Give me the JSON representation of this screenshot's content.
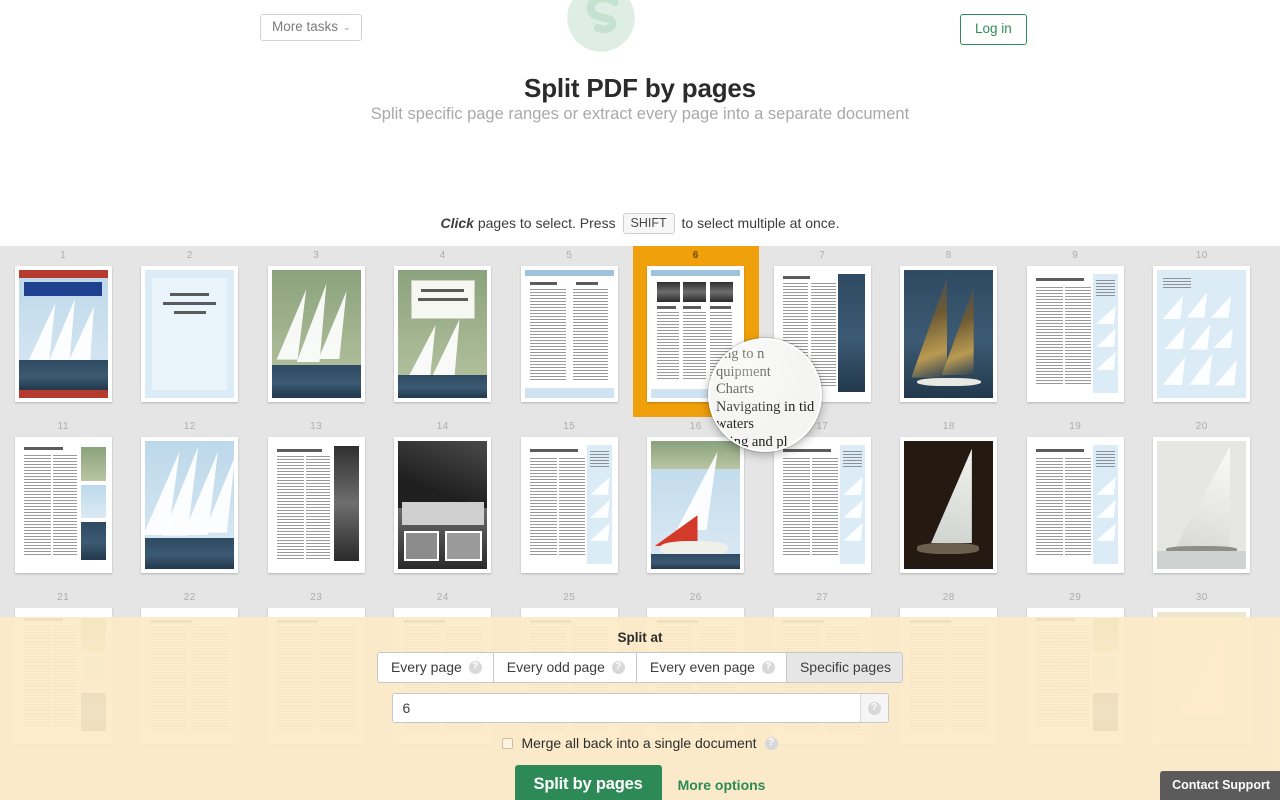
{
  "header": {
    "logo_icon": "sejda-s-logo-icon",
    "more_tasks_label": "More tasks",
    "more_tasks_caret": "⌄",
    "login_label": "Log in",
    "title": "Split PDF by pages",
    "subtitle": "Split specific page ranges or extract every page into a separate document"
  },
  "hint": {
    "click_word": "Click",
    "text_before": " pages to select. Press ",
    "kbd": "SHIFT",
    "text_after": " to select multiple at once."
  },
  "grid": {
    "selected_page": 6,
    "rows": [
      {
        "pages": [
          {
            "num": "1",
            "kind": "cover-color"
          },
          {
            "num": "2",
            "kind": "title-page"
          },
          {
            "num": "3",
            "kind": "photo-dinghies"
          },
          {
            "num": "4",
            "kind": "title-photo"
          },
          {
            "num": "5",
            "kind": "contents"
          },
          {
            "num": "6",
            "kind": "contents-photos",
            "selected": true
          },
          {
            "num": "7",
            "kind": "text-photo-right"
          },
          {
            "num": "8",
            "kind": "photo-gold-sails"
          },
          {
            "num": "9",
            "kind": "text-blue-sidebar"
          },
          {
            "num": "10",
            "kind": "diagram-boats"
          }
        ]
      },
      {
        "pages": [
          {
            "num": "11",
            "kind": "text-photo-strip"
          },
          {
            "num": "12",
            "kind": "photo-racing"
          },
          {
            "num": "13",
            "kind": "text-photo-bw"
          },
          {
            "num": "14",
            "kind": "photo-bw-sail"
          },
          {
            "num": "15",
            "kind": "text-blue-sidebar"
          },
          {
            "num": "16",
            "kind": "photo-dinghy-crew"
          },
          {
            "num": "17",
            "kind": "text-blue-sidebar"
          },
          {
            "num": "18",
            "kind": "photo-dark-yacht"
          },
          {
            "num": "19",
            "kind": "text-blue-sidebar"
          },
          {
            "num": "20",
            "kind": "photo-bw-yacht"
          }
        ]
      },
      {
        "pages": [
          {
            "num": "21",
            "kind": "text-photo-strip"
          },
          {
            "num": "22",
            "kind": "text-plain"
          },
          {
            "num": "23",
            "kind": "text-plain"
          },
          {
            "num": "24",
            "kind": "text-plain"
          },
          {
            "num": "25",
            "kind": "text-plain"
          },
          {
            "num": "26",
            "kind": "text-plain"
          },
          {
            "num": "27",
            "kind": "text-plain"
          },
          {
            "num": "28",
            "kind": "text-plain"
          },
          {
            "num": "29",
            "kind": "text-photo-strip"
          },
          {
            "num": "30",
            "kind": "photo-pale"
          }
        ]
      }
    ]
  },
  "magnifier": {
    "lines": [
      "ting to n",
      "quipment",
      "Charts",
      "Navigating in tid",
      "waters",
      "aping and pl"
    ]
  },
  "split_panel": {
    "split_at_label": "Split at",
    "tabs": [
      {
        "label": "Every page",
        "has_help": true,
        "active": false
      },
      {
        "label": "Every odd page",
        "has_help": true,
        "active": false
      },
      {
        "label": "Every even page",
        "has_help": true,
        "active": false
      },
      {
        "label": "Specific pages",
        "has_help": false,
        "active": true
      }
    ],
    "help_glyph": "?",
    "pages_input_value": "6",
    "pages_input_placeholder": "",
    "merge_label": "Merge all back into a single document",
    "merge_checked": false,
    "split_button_label": "Split by pages",
    "more_options_label": "More options"
  },
  "support": {
    "label": "Contact Support"
  },
  "colors": {
    "selection_orange": "#efa00b",
    "brand_green": "#2d8a56",
    "panel_amber": "#fdebc7",
    "grid_grey": "#e5e5e5"
  }
}
